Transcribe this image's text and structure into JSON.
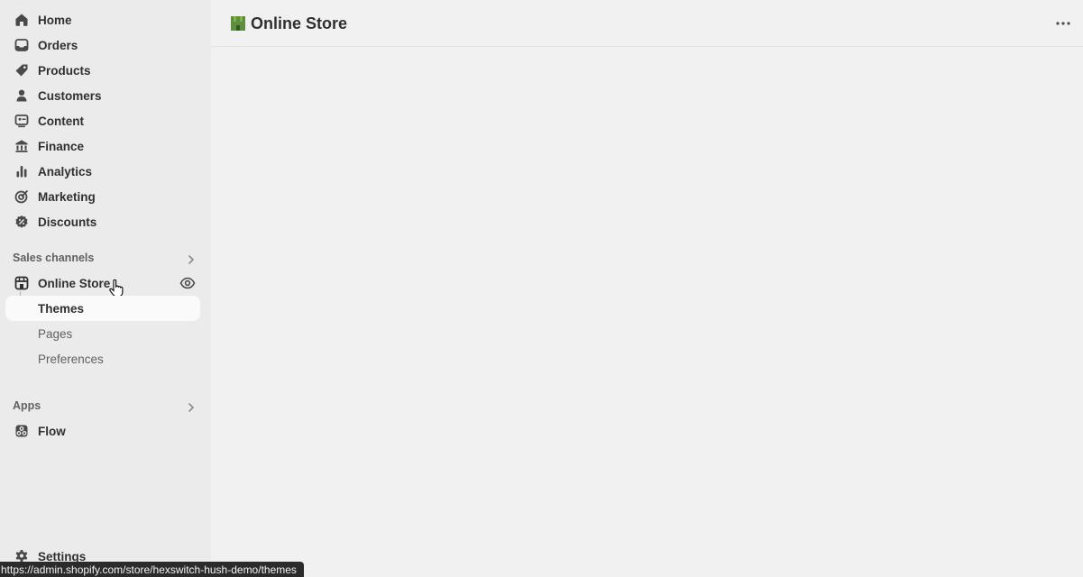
{
  "nav": {
    "items": [
      {
        "label": "Home",
        "icon": "home-icon"
      },
      {
        "label": "Orders",
        "icon": "inbox-icon"
      },
      {
        "label": "Products",
        "icon": "tag-icon"
      },
      {
        "label": "Customers",
        "icon": "person-icon"
      },
      {
        "label": "Content",
        "icon": "content-icon"
      },
      {
        "label": "Finance",
        "icon": "bank-icon"
      },
      {
        "label": "Analytics",
        "icon": "bar-chart-icon"
      },
      {
        "label": "Marketing",
        "icon": "target-icon"
      },
      {
        "label": "Discounts",
        "icon": "discount-icon"
      }
    ]
  },
  "sales_channels": {
    "title": "Sales channels",
    "online_store": {
      "label": "Online Store",
      "icon": "store-icon"
    },
    "sub_items": [
      {
        "label": "Themes"
      },
      {
        "label": "Pages"
      },
      {
        "label": "Preferences"
      }
    ]
  },
  "apps": {
    "title": "Apps",
    "items": [
      {
        "label": "Flow",
        "icon": "flow-icon"
      }
    ]
  },
  "settings": {
    "label": "Settings",
    "icon": "gear-icon"
  },
  "header": {
    "title": "Online Store",
    "logo_color": "#5e8e3e"
  },
  "status_bar": {
    "url": "https://admin.shopify.com/store/hexswitch-hush-demo/themes"
  }
}
